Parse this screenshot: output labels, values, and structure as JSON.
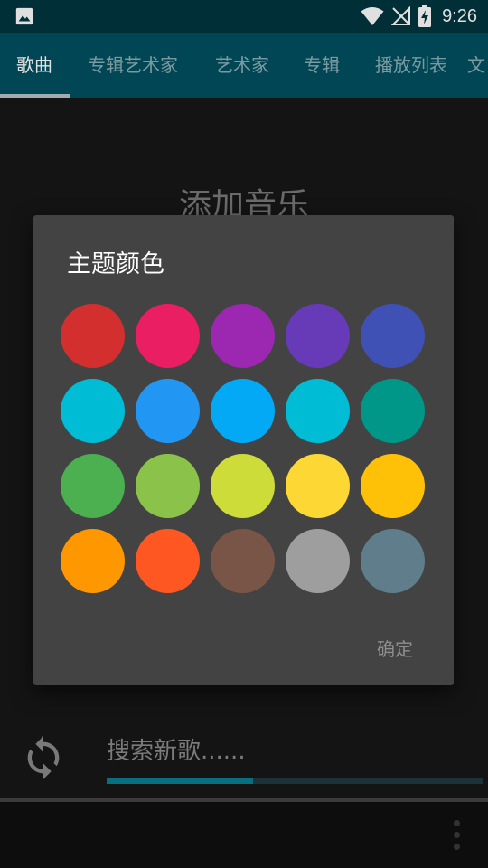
{
  "status_bar": {
    "time": "9:26",
    "icons": [
      "image-icon",
      "wifi-icon",
      "no-signal-icon",
      "battery-charging-icon"
    ]
  },
  "tabs": [
    {
      "label": "歌曲",
      "active": true
    },
    {
      "label": "专辑艺术家",
      "active": false
    },
    {
      "label": "艺术家",
      "active": false
    },
    {
      "label": "专辑",
      "active": false
    },
    {
      "label": "播放列表",
      "active": false
    },
    {
      "label": "文",
      "active": false
    }
  ],
  "main": {
    "add_music_label": "添加音乐",
    "search_placeholder": "搜索新歌......",
    "progress": 0.39
  },
  "dialog": {
    "title": "主题颜色",
    "ok_label": "确定",
    "swatches": [
      "#d32f2f",
      "#e91e63",
      "#9c27b0",
      "#673ab7",
      "#3f51b5",
      "#00bcd4",
      "#2196f3",
      "#03a9f4",
      "#00bcd4",
      "#009688",
      "#4caf50",
      "#8bc34a",
      "#cddc39",
      "#fdd835",
      "#ffc107",
      "#ff9800",
      "#ff5722",
      "#795548",
      "#9e9e9e",
      "#607d8b"
    ]
  }
}
